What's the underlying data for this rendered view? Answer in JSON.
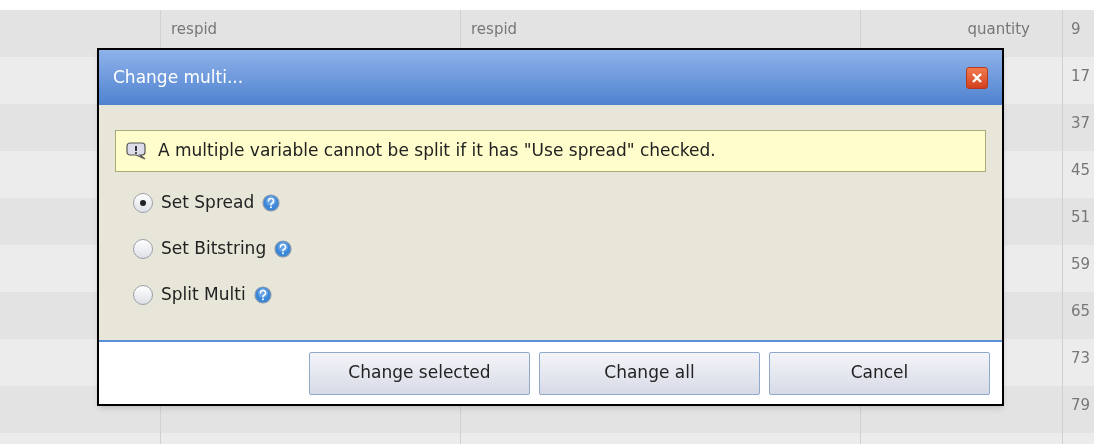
{
  "table": {
    "rows": [
      {
        "column_2": "respid",
        "column_3": "respid",
        "column_4": "quantity",
        "column_5": "9"
      },
      {
        "column_5": "17"
      },
      {
        "column_5": "37"
      },
      {
        "column_5": "45"
      },
      {
        "column_5": "51"
      },
      {
        "column_5": "59"
      },
      {
        "column_5": "65"
      },
      {
        "column_5": "73"
      },
      {
        "column_5": "79"
      }
    ]
  },
  "dialog": {
    "title": "Change multi...",
    "notice": "A multiple variable cannot be split if it has \"Use spread\" checked.",
    "options": [
      {
        "label": "Set Spread",
        "selected": true
      },
      {
        "label": "Set Bitstring",
        "selected": false
      },
      {
        "label": "Split Multi",
        "selected": false
      }
    ],
    "buttons": [
      "Change selected",
      "Change all",
      "Cancel"
    ]
  }
}
